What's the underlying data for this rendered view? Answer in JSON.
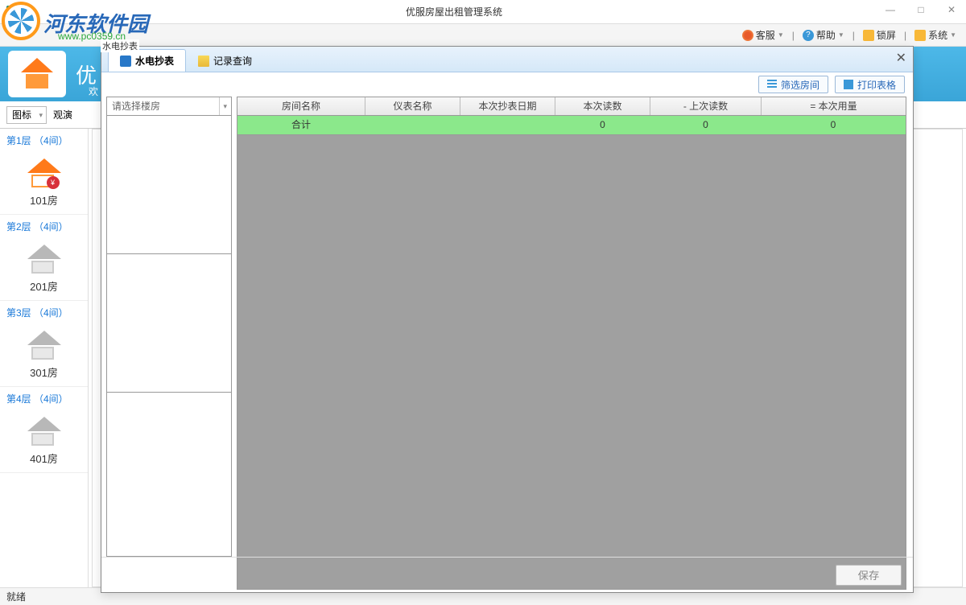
{
  "window": {
    "title": "优服房屋出租管理系统"
  },
  "menu": {
    "customer": "客服",
    "help": "帮助",
    "lock": "锁屏",
    "system": "系统"
  },
  "header": {
    "appName": "优",
    "welcome": "欢"
  },
  "toolbar": {
    "viewMode": "图标",
    "observe": "观演"
  },
  "floors": [
    {
      "header": "第1层 （4间）",
      "room": "101房",
      "active": true
    },
    {
      "header": "第2层 （4间）",
      "room": "201房",
      "active": false
    },
    {
      "header": "第3层 （4间）",
      "room": "301房",
      "active": false
    },
    {
      "header": "第4层 （4间）",
      "room": "401房",
      "active": false
    }
  ],
  "modal": {
    "tinyTitle": "水电抄表",
    "tab1": "水电抄表",
    "tab2": "记录查询",
    "filterBtn": "筛选房间",
    "printBtn": "打印表格",
    "buildingPlaceholder": "请选择楼房",
    "columns": {
      "c0": "房间名称",
      "c1": "仪表名称",
      "c2": "本次抄表日期",
      "c3": "本次读数",
      "c4": "-      上次读数",
      "c5": "=      本次用量"
    },
    "total": {
      "label": "合计",
      "v3": "0",
      "v4": "0",
      "v5": "0"
    },
    "save": "保存"
  },
  "status": "就绪",
  "watermark": {
    "text": "河东软件园",
    "url": "www.pc0359.cn"
  }
}
